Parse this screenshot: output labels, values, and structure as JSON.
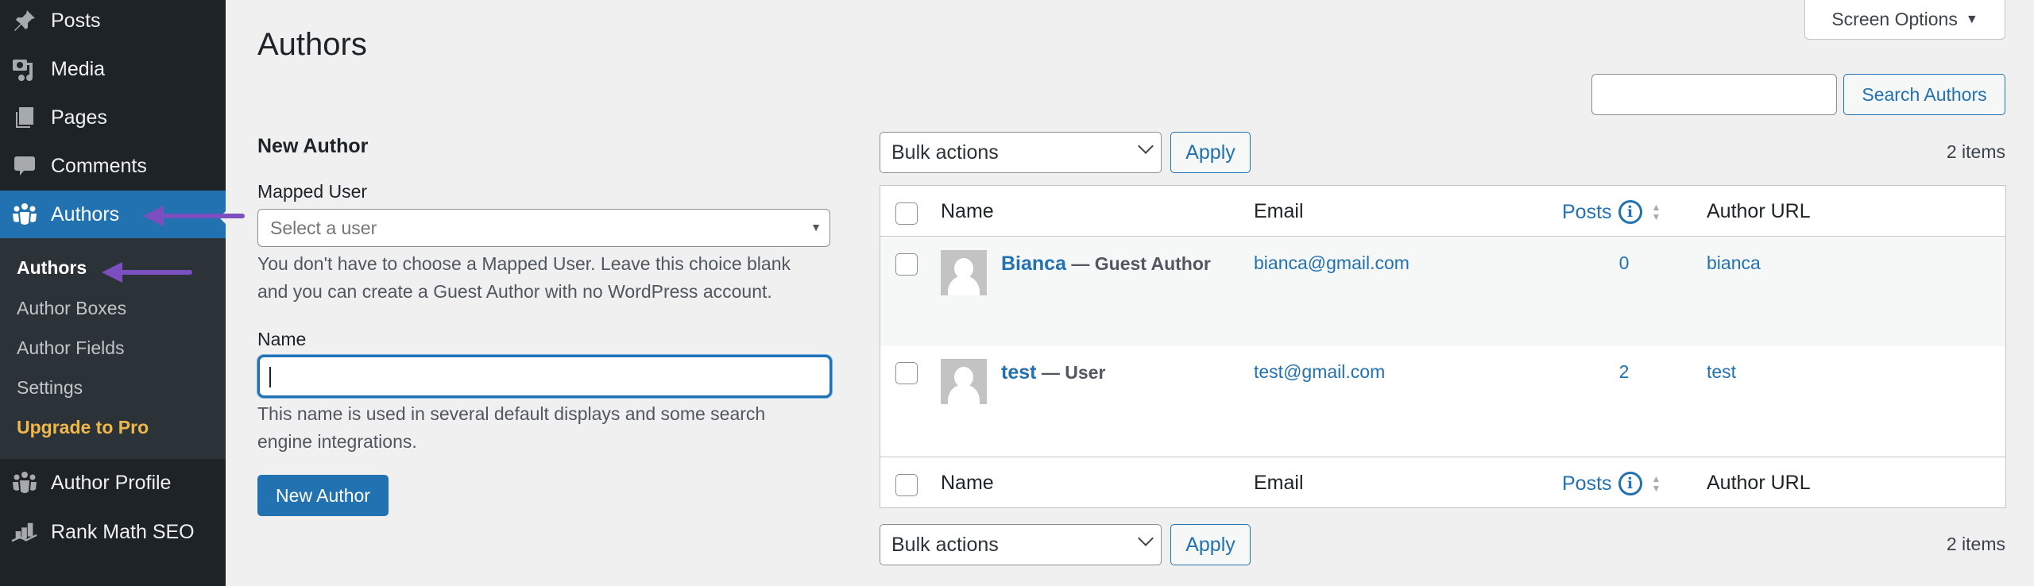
{
  "sidebar": {
    "menu": [
      {
        "label": "Posts",
        "icon": "pushpin-icon"
      },
      {
        "label": "Media",
        "icon": "media-icon"
      },
      {
        "label": "Pages",
        "icon": "pages-icon"
      },
      {
        "label": "Comments",
        "icon": "comments-icon"
      },
      {
        "label": "Authors",
        "icon": "authors-icon",
        "active": true
      },
      {
        "label": "Author Profile",
        "icon": "author-profile-icon"
      },
      {
        "label": "Rank Math SEO",
        "icon": "rank-math-icon"
      }
    ],
    "submenu": [
      {
        "label": "Authors",
        "current": true
      },
      {
        "label": "Author Boxes"
      },
      {
        "label": "Author Fields"
      },
      {
        "label": "Settings"
      },
      {
        "label": "Upgrade to Pro",
        "highlight": true
      }
    ]
  },
  "header": {
    "title": "Authors",
    "screen_options": "Screen Options",
    "search_button": "Search Authors",
    "search_value": ""
  },
  "form": {
    "heading": "New Author",
    "mapped_user_label": "Mapped User",
    "mapped_user_placeholder": "Select a user",
    "mapped_user_desc_1": "You don't have to choose a Mapped User. Leave this choice blank",
    "mapped_user_desc_2": "and you can create a Guest Author with no WordPress account.",
    "name_label": "Name",
    "name_value": "",
    "name_desc_1": "This name is used in several default displays and some search",
    "name_desc_2": "engine integrations.",
    "submit_label": "New Author"
  },
  "table": {
    "bulk_actions": "Bulk actions",
    "apply": "Apply",
    "items_count": "2 items",
    "columns": [
      "Name",
      "Email",
      "Posts",
      "Author URL"
    ],
    "rows": [
      {
        "name": "Bianca",
        "role": "— Guest Author",
        "email": "bianca@gmail.com",
        "posts": "0",
        "url": "bianca"
      },
      {
        "name": "test",
        "role": "— User",
        "email": "test@gmail.com",
        "posts": "2",
        "url": "test"
      }
    ]
  },
  "colors": {
    "accent": "#2271b1",
    "sidebar_bg": "#1d2327",
    "submenu_bg": "#2c3338",
    "upgrade": "#f0b849",
    "annotation_arrow": "#7b4fc0"
  }
}
